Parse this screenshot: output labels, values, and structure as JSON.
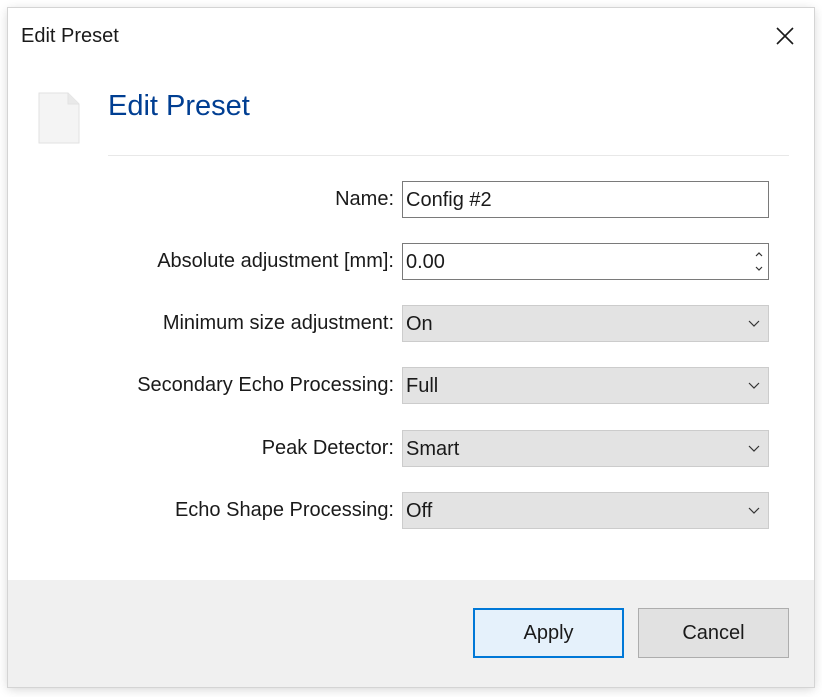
{
  "window": {
    "title": "Edit Preset"
  },
  "header": {
    "title": "Edit Preset",
    "icon": "document-icon"
  },
  "fields": {
    "name": {
      "label": "Name:",
      "value": "Config #2"
    },
    "absolute_adjustment": {
      "label": "Absolute adjustment [mm]:",
      "value": "0.00"
    },
    "minimum_size_adjustment": {
      "label": "Minimum size adjustment:",
      "value": "On"
    },
    "secondary_echo_processing": {
      "label": "Secondary Echo Processing:",
      "value": "Full"
    },
    "peak_detector": {
      "label": "Peak Detector:",
      "value": "Smart"
    },
    "echo_shape_processing": {
      "label": "Echo Shape Processing:",
      "value": "Off"
    }
  },
  "buttons": {
    "apply": "Apply",
    "cancel": "Cancel"
  },
  "colors": {
    "header_title": "#003e92",
    "accent": "#0078d7",
    "footer_bg": "#f0f0f0"
  }
}
